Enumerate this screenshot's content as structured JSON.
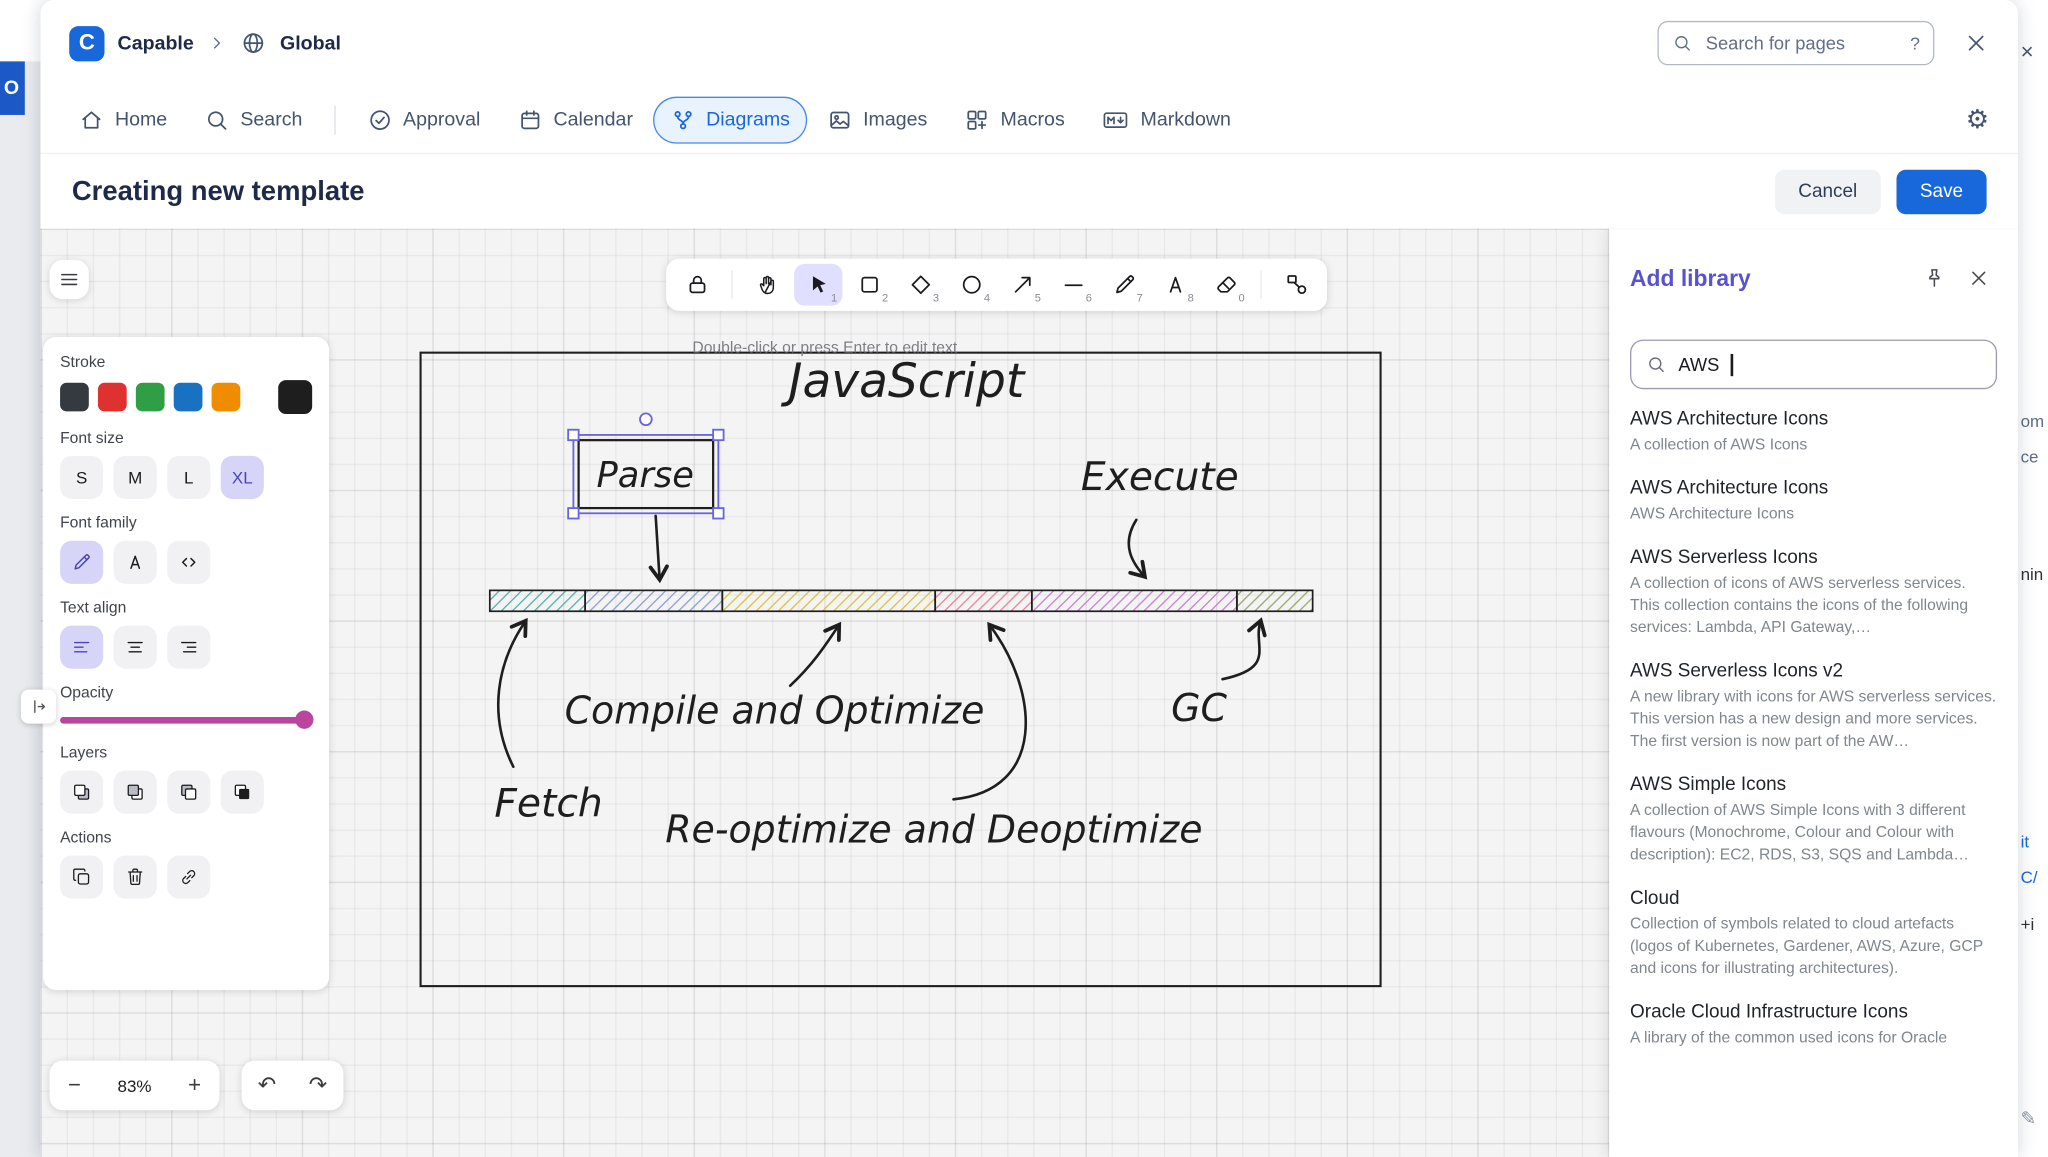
{
  "header": {
    "logo_letter": "C",
    "brand": "Capable",
    "space": "Global",
    "search_placeholder": "Search for pages",
    "help": "?"
  },
  "nav": {
    "items": [
      "Home",
      "Search",
      "Approval",
      "Calendar",
      "Diagrams",
      "Images",
      "Macros",
      "Markdown"
    ],
    "active": "Diagrams"
  },
  "page": {
    "title": "Creating new template",
    "cancel": "Cancel",
    "save": "Save"
  },
  "toolbar_keys": {
    "select": "1",
    "rectangle": "2",
    "diamond": "3",
    "ellipse": "4",
    "arrow": "5",
    "line": "6",
    "draw": "7",
    "text": "8",
    "eraser": "0"
  },
  "canvas": {
    "hint": "Double-click or press Enter to edit text",
    "zoom_out": "−",
    "zoom_value": "83%",
    "zoom_in": "+",
    "undo": "↶",
    "redo": "↷"
  },
  "glyphs": {
    "gear": "⚙"
  },
  "props": {
    "stroke_label": "Stroke",
    "font_size_label": "Font size",
    "sizes": [
      "S",
      "M",
      "L",
      "XL"
    ],
    "active_size": "XL",
    "font_family_label": "Font family",
    "text_align_label": "Text align",
    "opacity_label": "Opacity",
    "layers_label": "Layers",
    "actions_label": "Actions",
    "stroke_colors": {
      "gray": "#343a40",
      "red": "#e03131",
      "green": "#2f9e44",
      "blue": "#1971c2",
      "orange": "#f08c00",
      "current": "#1e1e1e"
    },
    "opacity_color": "#b9459c"
  },
  "diagram": {
    "title": "JavaScript",
    "parse": "Parse",
    "execute": "Execute",
    "fetch": "Fetch",
    "compile": "Compile and Optimize",
    "reoptimize": "Re-optimize and Deoptimize",
    "gc": "GC"
  },
  "library": {
    "title": "Add library",
    "search_value": "AWS",
    "items": [
      {
        "title": "AWS Architecture Icons",
        "description": "A collection of AWS Icons"
      },
      {
        "title": "AWS Architecture Icons",
        "description": "AWS Architecture Icons"
      },
      {
        "title": "AWS Serverless Icons",
        "description": "A collection of icons of AWS serverless services. This collection contains the icons of the following services: Lambda, API Gateway,…"
      },
      {
        "title": "AWS Serverless Icons v2",
        "description": "A new library with icons for AWS serverless services. This version has a new design and more services. The first version is now part of the AW…"
      },
      {
        "title": "AWS Simple Icons",
        "description": "A collection of AWS Simple Icons with 3 different flavours (Monochrome, Colour and Colour with description): EC2, RDS, S3, SQS and Lambda…"
      },
      {
        "title": "Cloud",
        "description": "Collection of symbols related to cloud artefacts (logos of Kubernetes, Gardener, AWS, Azure, GCP and icons for illustrating architectures)."
      },
      {
        "title": "Oracle Cloud Infrastructure Icons",
        "description": "A library of the common used icons for Oracle"
      }
    ]
  },
  "edge": {
    "page_close": "×",
    "fragment_1": "om",
    "fragment_2": "ce",
    "fragment_3": "nin",
    "fragment_4": "it",
    "fragment_5": "C/",
    "fragment_6": "+i",
    "pencil_glyph": "✎",
    "gutter_letter": "O"
  },
  "colors": {
    "brand_blue": "#1868db",
    "active_tab_bg": "#e9f2ff",
    "library_accent": "#5753d0",
    "selection": "#6965db"
  }
}
